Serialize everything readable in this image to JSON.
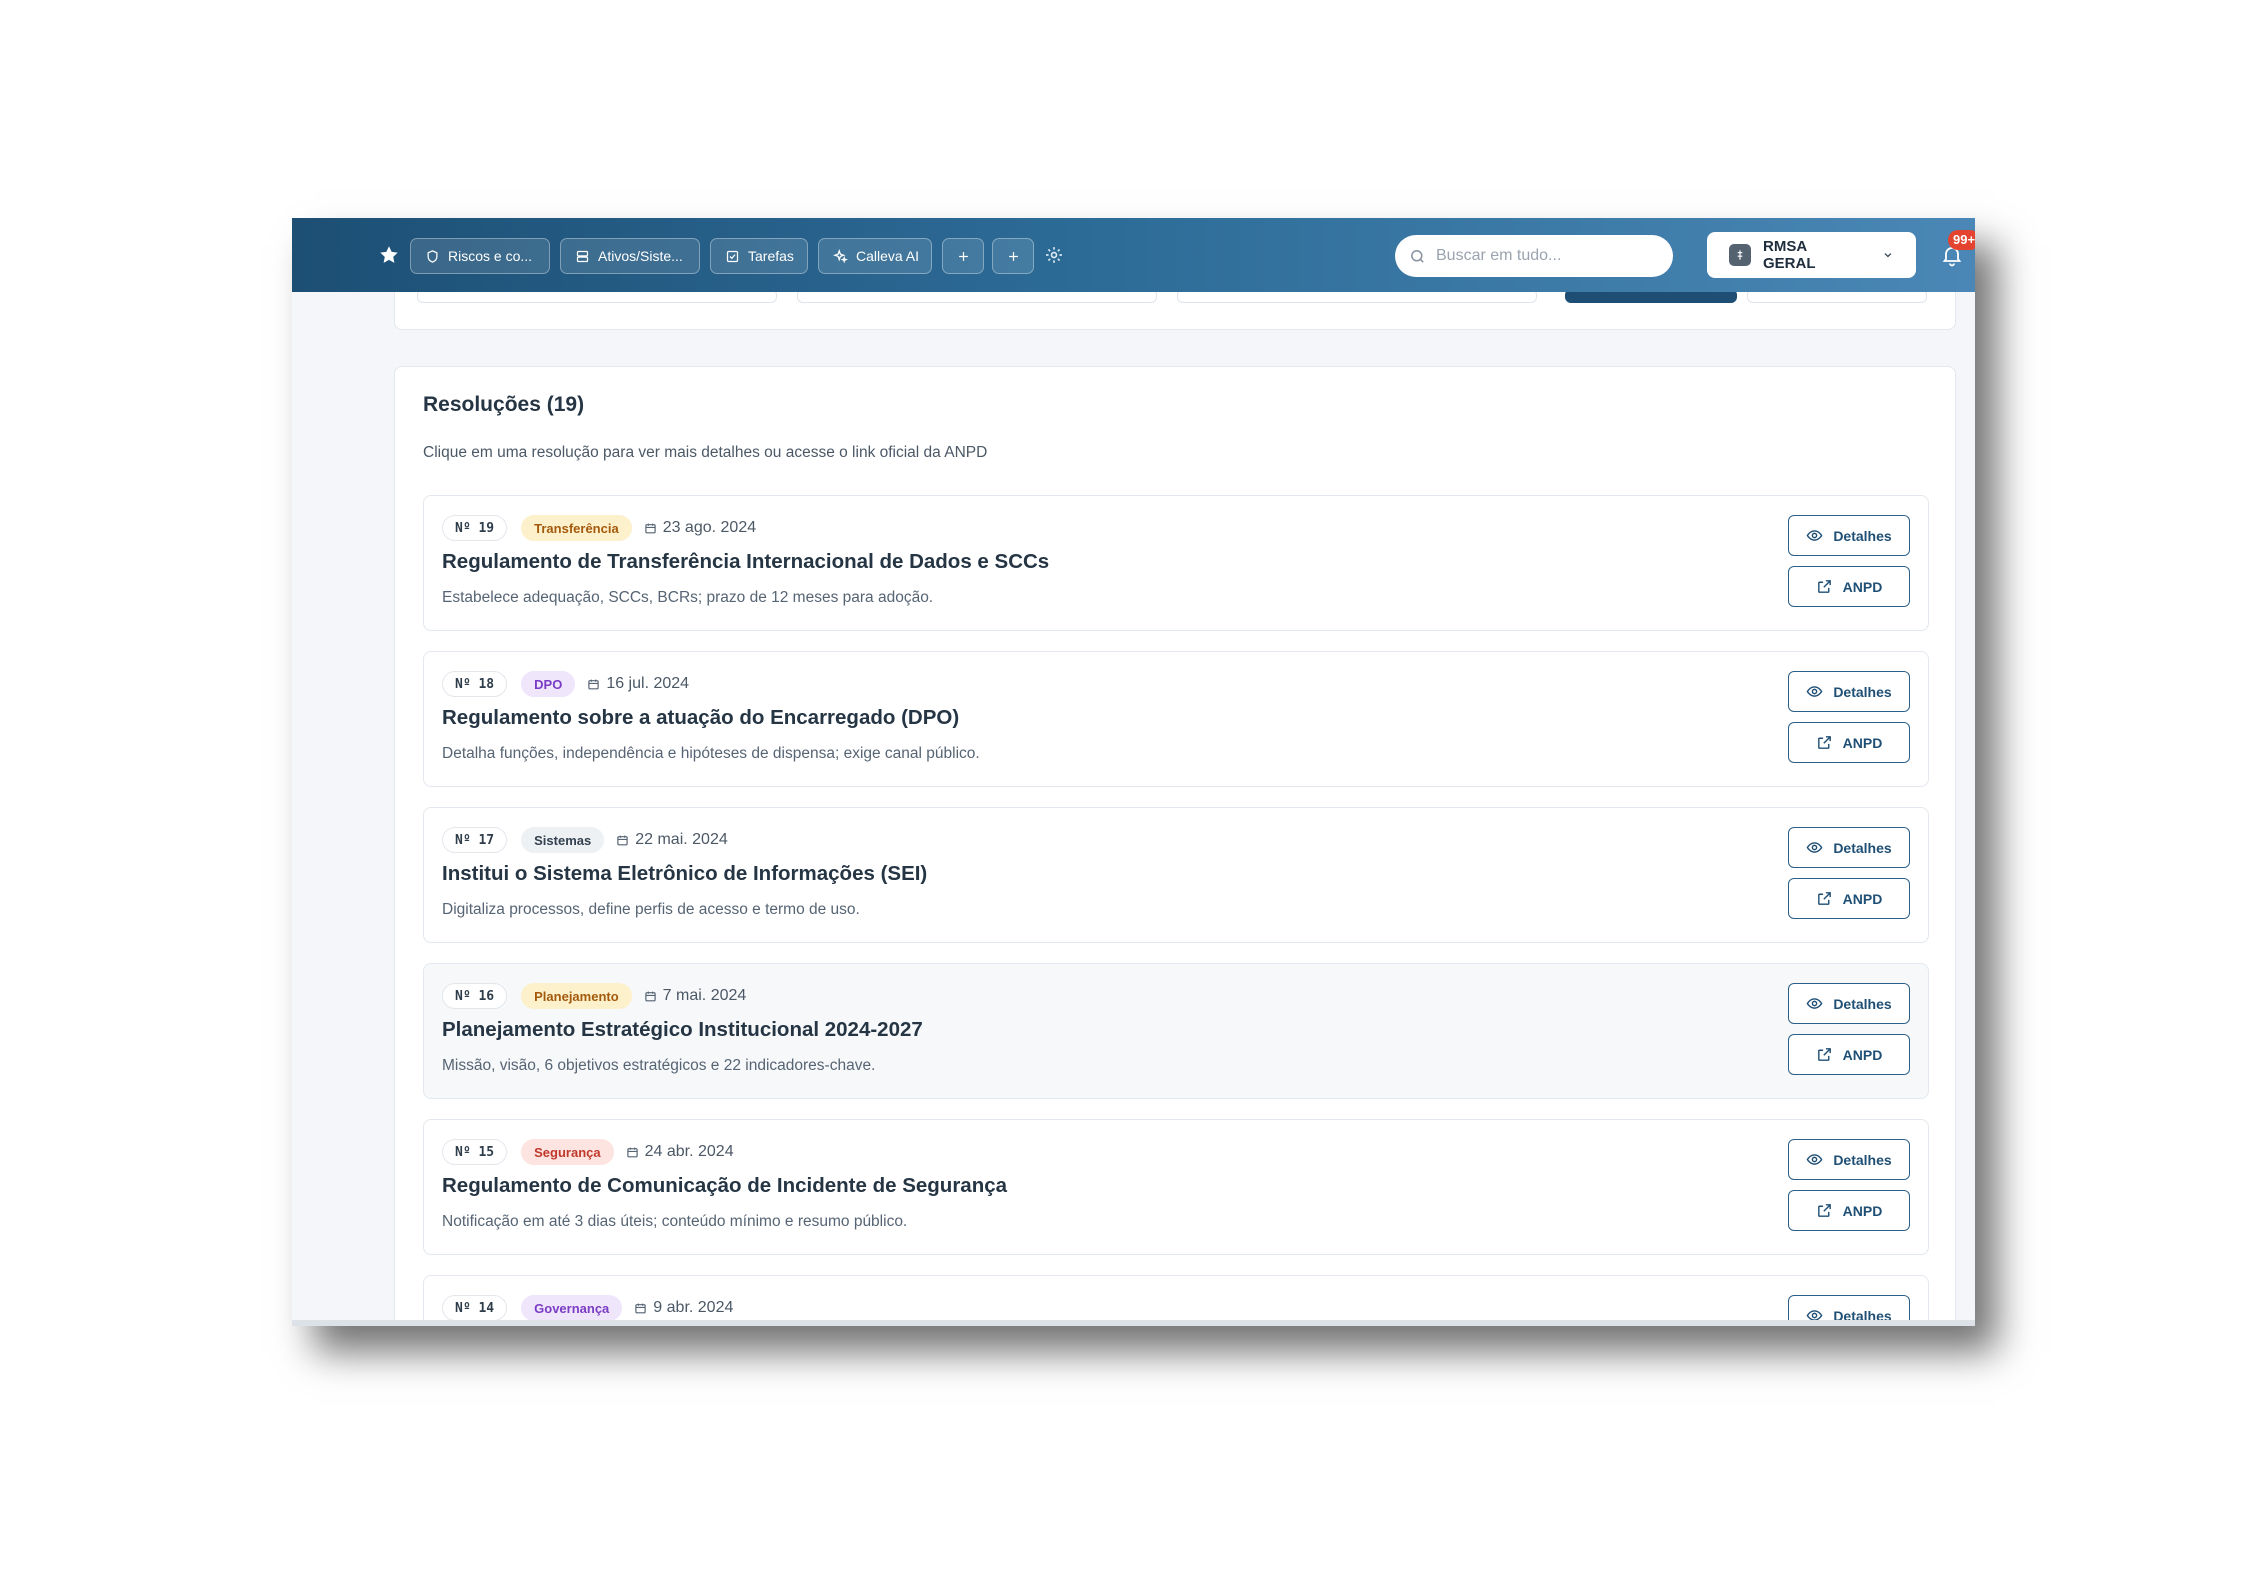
{
  "nav": {
    "tabs": [
      {
        "label": "Riscos e co...",
        "icon": "shield-icon"
      },
      {
        "label": "Ativos/Siste...",
        "icon": "server-icon"
      },
      {
        "label": "Tarefas",
        "icon": "checkbox-icon"
      },
      {
        "label": "Calleva AI",
        "icon": "sparkles-icon"
      }
    ],
    "search_placeholder": "Buscar em tudo...",
    "org_name": "RMSA GERAL",
    "notification_badge": "99+"
  },
  "resolutions": {
    "title": "Resoluções (19)",
    "subtitle": "Clique em uma resolução para ver mais detalhes ou acesse o link oficial da ANPD",
    "details_label": "Detalhes",
    "anpd_label": "ANPD",
    "items": [
      {
        "number": "Nº 19",
        "tag": "Transferência",
        "tag_color": "#fdf1cc",
        "tag_text_color": "#a35a0c",
        "date": "23 ago. 2024",
        "title": "Regulamento de Transferência Internacional de Dados e SCCs",
        "description": "Estabelece adequação, SCCs, BCRs; prazo de 12 meses para adoção."
      },
      {
        "number": "Nº 18",
        "tag": "DPO",
        "tag_color": "#efe6fb",
        "tag_text_color": "#7a3cc4",
        "date": "16 jul. 2024",
        "title": "Regulamento sobre a atuação do Encarregado (DPO)",
        "description": "Detalha funções, independência e hipóteses de dispensa; exige canal público."
      },
      {
        "number": "Nº 17",
        "tag": "Sistemas",
        "tag_color": "#eef1f4",
        "tag_text_color": "#33414f",
        "date": "22 mai. 2024",
        "title": "Institui o Sistema Eletrônico de Informações (SEI)",
        "description": "Digitaliza processos, define perfis de acesso e termo de uso."
      },
      {
        "number": "Nº 16",
        "tag": "Planejamento",
        "tag_color": "#fdf1cc",
        "tag_text_color": "#a35a0c",
        "date": "7 mai. 2024",
        "title": "Planejamento Estratégico Institucional 2024-2027",
        "description": "Missão, visão, 6 objetivos estratégicos e 22 indicadores-chave."
      },
      {
        "number": "Nº 15",
        "tag": "Segurança",
        "tag_color": "#fde4e1",
        "tag_text_color": "#c0392b",
        "date": "24 abr. 2024",
        "title": "Regulamento de Comunicação de Incidente de Segurança",
        "description": "Notificação em até 3 dias úteis; conteúdo mínimo e resumo público."
      },
      {
        "number": "Nº 14",
        "tag": "Governança",
        "tag_color": "#efe6fb",
        "tag_text_color": "#7a3cc4",
        "date": "9 abr. 2024",
        "title": "",
        "description": ""
      }
    ]
  }
}
